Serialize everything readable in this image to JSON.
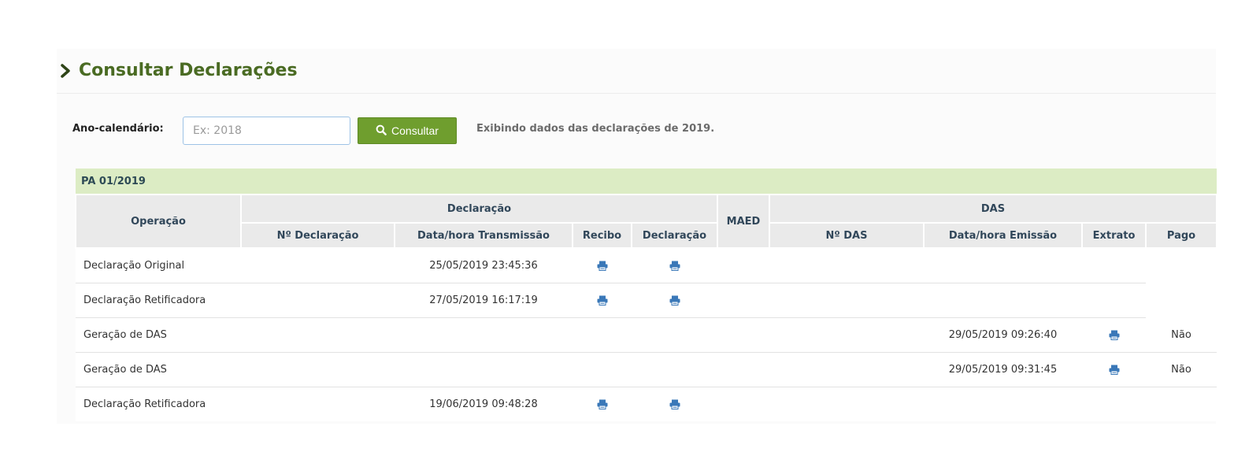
{
  "page": {
    "title": "Consultar Declarações"
  },
  "filter": {
    "label": "Ano-calendário:",
    "year_placeholder": "Ex: 2018",
    "year_value": "",
    "consultar_label": "Consultar",
    "showing_text": "Exibindo dados das declarações de 2019."
  },
  "table": {
    "period": "PA 01/2019",
    "headers": {
      "operacao": "Operação",
      "declaracao": "Declaração",
      "maed": "MAED",
      "das": "DAS",
      "no_declaracao": "Nº Declaração",
      "data_transmissao": "Data/hora Transmissão",
      "recibo": "Recibo",
      "declaracao_doc": "Declaração",
      "no_das": "Nº DAS",
      "data_emissao": "Data/hora Emissão",
      "extrato": "Extrato",
      "pago": "Pago"
    },
    "rows": [
      {
        "operacao": "Declaração Original",
        "no_declaracao": "",
        "transmissao": "25/05/2019 23:45:36",
        "recibo_icon": "print-icon",
        "declaracao_icon": "print-icon",
        "maed": "",
        "no_das": "",
        "emissao": "",
        "extrato_icon": "",
        "pago": ""
      },
      {
        "operacao": "Declaração Retificadora",
        "no_declaracao": "",
        "transmissao": "27/05/2019 16:17:19",
        "recibo_icon": "print-icon",
        "declaracao_icon": "print-icon",
        "maed": "",
        "no_das": "",
        "emissao": "",
        "extrato_icon": "",
        "pago": ""
      },
      {
        "operacao": "Geração de DAS",
        "no_declaracao": "",
        "transmissao": "",
        "recibo_icon": "",
        "declaracao_icon": "",
        "maed": "",
        "no_das": "",
        "emissao": "29/05/2019 09:26:40",
        "extrato_icon": "print-icon",
        "pago": "Não"
      },
      {
        "operacao": "Geração de DAS",
        "no_declaracao": "",
        "transmissao": "",
        "recibo_icon": "",
        "declaracao_icon": "",
        "maed": "",
        "no_das": "",
        "emissao": "29/05/2019 09:31:45",
        "extrato_icon": "print-icon",
        "pago": "Não"
      },
      {
        "operacao": "Declaração Retificadora",
        "no_declaracao": "",
        "transmissao": "19/06/2019 09:48:28",
        "recibo_icon": "print-icon",
        "declaracao_icon": "print-icon",
        "maed": "",
        "no_das": "",
        "emissao": "",
        "extrato_icon": "",
        "pago": ""
      }
    ]
  },
  "colors": {
    "title_green": "#4a6b23",
    "button_green": "#6f9e2e",
    "period_band": "#dcecc4",
    "header_gray": "#eaeaea",
    "print_icon_blue": "#3a78b8"
  }
}
